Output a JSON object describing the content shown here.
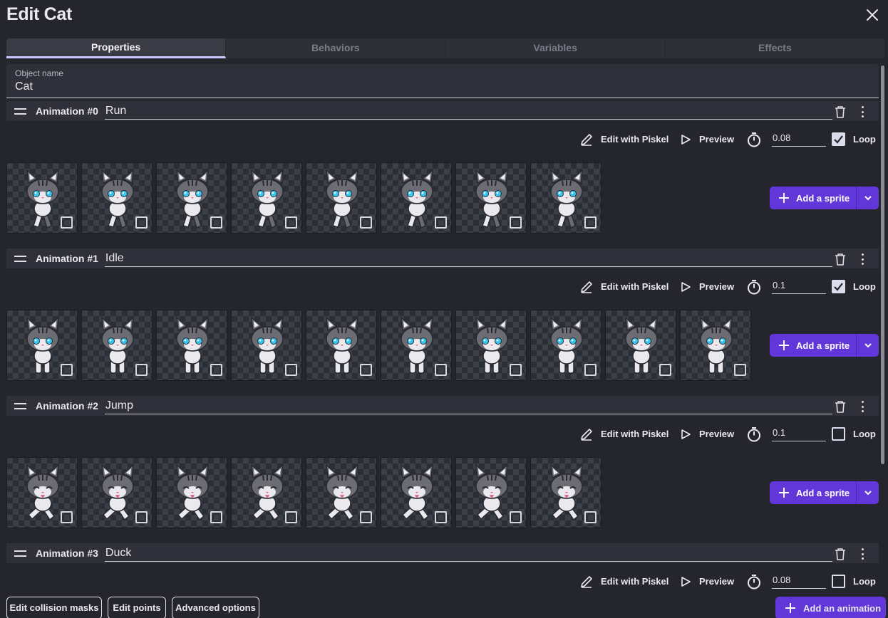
{
  "dialog": {
    "title": "Edit Cat"
  },
  "tabs": [
    {
      "label": "Properties",
      "active": true
    },
    {
      "label": "Behaviors",
      "active": false
    },
    {
      "label": "Variables",
      "active": false
    },
    {
      "label": "Effects",
      "active": false
    }
  ],
  "object_name": {
    "label": "Object name",
    "value": "Cat"
  },
  "tool_labels": {
    "edit": "Edit with Piskel",
    "preview": "Preview",
    "loop": "Loop",
    "add_sprite": "Add a sprite"
  },
  "animations": [
    {
      "number_label": "Animation #0",
      "name": "Run",
      "speed": "0.08",
      "loop": true,
      "frame_count": 8,
      "pose": "run"
    },
    {
      "number_label": "Animation #1",
      "name": "Idle",
      "speed": "0.1",
      "loop": true,
      "frame_count": 10,
      "pose": "idle"
    },
    {
      "number_label": "Animation #2",
      "name": "Jump",
      "speed": "0.1",
      "loop": false,
      "frame_count": 8,
      "pose": "jump"
    },
    {
      "number_label": "Animation #3",
      "name": "Duck",
      "speed": "0.08",
      "loop": false,
      "frame_count": 0,
      "pose": "duck"
    }
  ],
  "footer": {
    "edit_collision_masks": "Edit collision masks",
    "edit_points": "Edit points",
    "advanced_options": "Advanced options",
    "add_animation": "Add an animation"
  },
  "colors": {
    "accent": "#6237d9",
    "active_tab_underline": "#c9c7ff"
  },
  "icons": [
    "close-icon",
    "drag-handle-icon",
    "trash-icon",
    "more-vert-icon",
    "pencil-icon",
    "play-icon",
    "timer-icon",
    "checkbox-icon",
    "plus-icon",
    "chevron-down-icon"
  ]
}
